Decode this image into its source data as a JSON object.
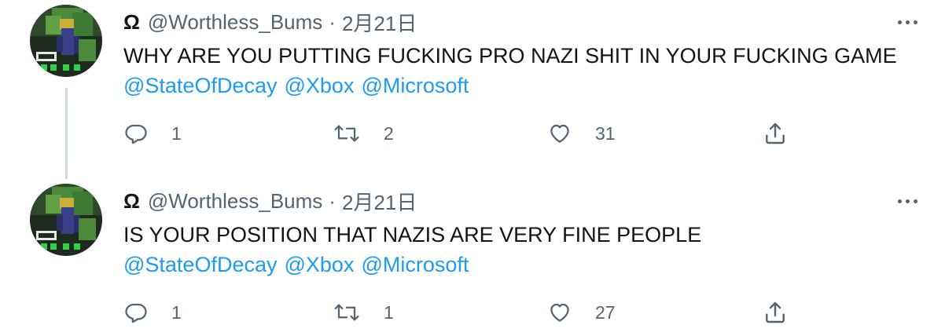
{
  "tweets": [
    {
      "author_icon": "Ω",
      "handle": "@Worthless_Bums",
      "separator": "·",
      "date": "2月21日",
      "text": "WHY ARE YOU PUTTING FUCKING PRO NAZI SHIT IN YOUR FUCKING GAME",
      "mentions": [
        "@StateOfDecay",
        "@Xbox",
        "@Microsoft"
      ],
      "replies": "1",
      "retweets": "2",
      "likes": "31"
    },
    {
      "author_icon": "Ω",
      "handle": "@Worthless_Bums",
      "separator": "·",
      "date": "2月21日",
      "text": "IS YOUR POSITION THAT NAZIS ARE VERY FINE PEOPLE",
      "mentions": [
        "@StateOfDecay",
        "@Xbox",
        "@Microsoft"
      ],
      "replies": "1",
      "retweets": "1",
      "likes": "27"
    }
  ],
  "colors": {
    "link": "#1d9bf0",
    "secondary_text": "#536471",
    "primary_text": "#0f1419",
    "thread_line": "#cfd9de"
  },
  "icons": {
    "reply": "reply-icon",
    "retweet": "retweet-icon",
    "like": "heart-icon",
    "share": "share-icon",
    "more": "more-options-icon"
  }
}
